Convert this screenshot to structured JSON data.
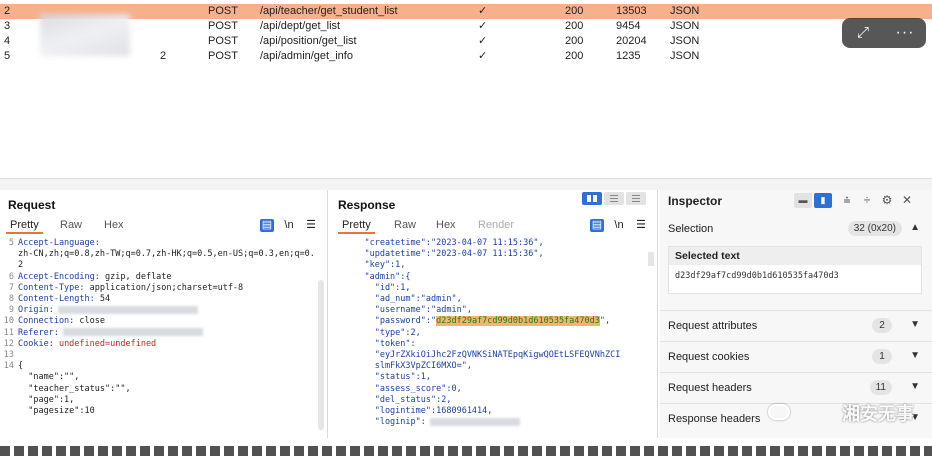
{
  "history": {
    "rows": [
      {
        "num": "2",
        "host_tail": "",
        "method": "POST",
        "url": "/api/teacher/get_student_list",
        "check": "✓",
        "status": "200",
        "length": "13503",
        "mime": "JSON",
        "selected": true
      },
      {
        "num": "3",
        "host_tail": "",
        "method": "POST",
        "url": "/api/dept/get_list",
        "check": "✓",
        "status": "200",
        "length": "9454",
        "mime": "JSON",
        "selected": false
      },
      {
        "num": "4",
        "host_tail": "",
        "method": "POST",
        "url": "/api/position/get_list",
        "check": "✓",
        "status": "200",
        "length": "20204",
        "mime": "JSON",
        "selected": false
      },
      {
        "num": "5",
        "host_tail": "2",
        "method": "POST",
        "url": "/api/admin/get_info",
        "check": "✓",
        "status": "200",
        "length": "1235",
        "mime": "JSON",
        "selected": false
      }
    ]
  },
  "overlay": {
    "expand_icon": "expand-icon",
    "more_label": "···"
  },
  "request": {
    "title": "Request",
    "tabs": [
      "Pretty",
      "Raw",
      "Hex"
    ],
    "lines": [
      {
        "n": "5",
        "key": "Accept-Language:",
        "val": ""
      },
      {
        "n": "",
        "key": "",
        "val": "zh-CN,zh;q=0.8,zh-TW;q=0.7,zh-HK;q=0.5,en-US;q=0.3,en;q=0."
      },
      {
        "n": "",
        "key": "",
        "val": "2"
      },
      {
        "n": "6",
        "key": "Accept-Encoding:",
        "val": " gzip, deflate"
      },
      {
        "n": "7",
        "key": "Content-Type:",
        "val": " application/json;charset=utf-8"
      },
      {
        "n": "8",
        "key": "Content-Length:",
        "val": " 54"
      },
      {
        "n": "9",
        "key": "Origin:",
        "val": ""
      },
      {
        "n": "10",
        "key": "Connection:",
        "val": " close"
      },
      {
        "n": "11",
        "key": "Referer:",
        "val": ""
      },
      {
        "n": "12",
        "key": "Cookie:",
        "val": " undefined=undefined"
      },
      {
        "n": "13",
        "key": "",
        "val": ""
      },
      {
        "n": "14",
        "key": "",
        "val": "{"
      },
      {
        "n": "",
        "key": "",
        "val": "  \"name\":\"\","
      },
      {
        "n": "",
        "key": "",
        "val": "  \"teacher_status\":\"\","
      },
      {
        "n": "",
        "key": "",
        "val": "  \"page\":1,"
      },
      {
        "n": "",
        "key": "",
        "val": "  \"pagesize\":10"
      }
    ]
  },
  "response": {
    "title": "Response",
    "tabs": [
      "Pretty",
      "Raw",
      "Hex",
      "Render"
    ],
    "lines": [
      "    \"createtime\":\"2023-04-07 11:15:36\",",
      "    \"updatetime\":\"2023-04-07 11:15:36\",",
      "    \"key\":1,",
      "    \"admin\":{",
      "      \"id\":1,",
      "      \"ad_num\":\"admin\",",
      "      \"username\":\"admin\",",
      "      \"password\":\"d23df29af7cd99d0b1d610535fa470d3\",",
      "      \"type\":2,",
      "      \"token\":",
      "      \"eyJrZXkiOiJhc2FzQVNKSiNATEpqKigwQOEtLSFEQVNhZCI",
      "      slmFkX3VpZCI6MXO=\",",
      "      \"status\":1,",
      "      \"assess_score\":0,",
      "      \"del_status\":2,",
      "      \"logintime\":1680961414,",
      "      \"loginip\":"
    ]
  },
  "inspector": {
    "title": "Inspector",
    "selection_label": "Selection",
    "selection_badge": "32 (0x20)",
    "selected_text_label": "Selected text",
    "selected_text_value": "d23df29af7cd99d0b1d610535fa470d3",
    "rows": [
      {
        "label": "Request attributes",
        "count": "2"
      },
      {
        "label": "Request cookies",
        "count": "1"
      },
      {
        "label": "Request headers",
        "count": "11"
      },
      {
        "label": "Response headers",
        "count": ""
      }
    ]
  },
  "watermark": "湘安无事"
}
